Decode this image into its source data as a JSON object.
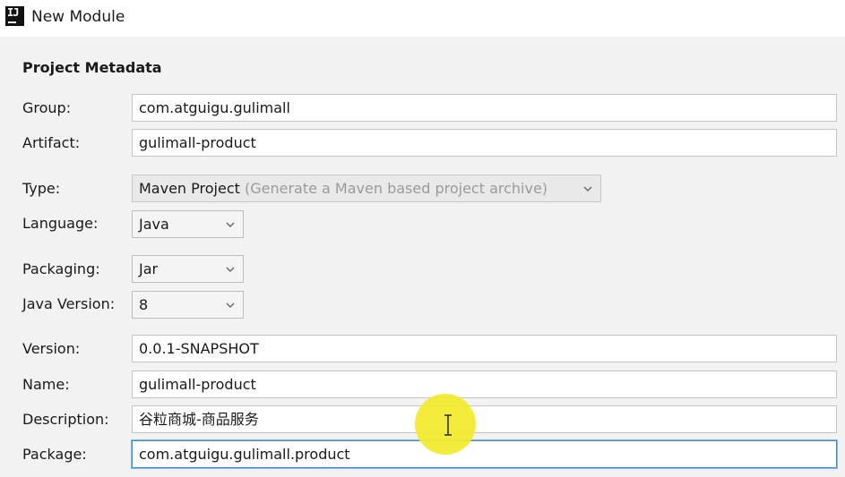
{
  "window": {
    "title": "New Module",
    "icon": "intellij-idea-icon",
    "icon_text": "IJ"
  },
  "section": {
    "title": "Project Metadata"
  },
  "fields": {
    "group": {
      "label": "Group:",
      "value": "com.atguigu.gulimall"
    },
    "artifact": {
      "label": "Artifact:",
      "value": "gulimall-product"
    },
    "type": {
      "label": "Type:",
      "value": "Maven Project",
      "hint": "(Generate a Maven based project archive)"
    },
    "language": {
      "label": "Language:",
      "value": "Java"
    },
    "packaging": {
      "label": "Packaging:",
      "value": "Jar"
    },
    "java_version": {
      "label": "Java Version:",
      "value": "8"
    },
    "version": {
      "label": "Version:",
      "value": "0.0.1-SNAPSHOT"
    },
    "name": {
      "label": "Name:",
      "value": "gulimall-product"
    },
    "description": {
      "label": "Description:",
      "value": "谷粒商城-商品服务"
    },
    "package": {
      "label": "Package:",
      "value": "com.atguigu.gulimall.product"
    }
  },
  "colors": {
    "focus_border": "#3d8fd6",
    "cursor_highlight": "#f2ea2a"
  }
}
